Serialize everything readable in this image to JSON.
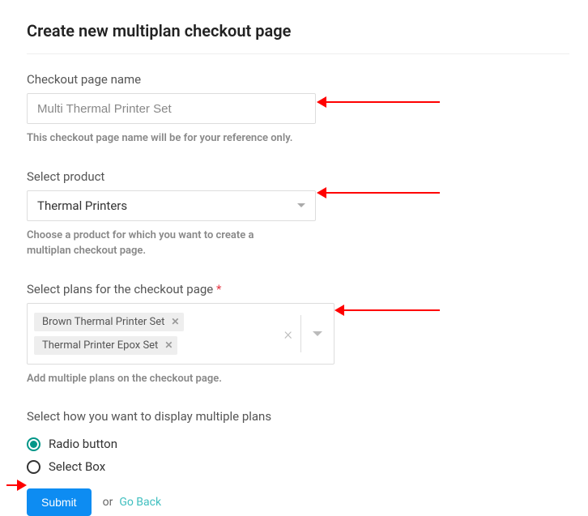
{
  "title": "Create new multiplan checkout page",
  "fields": {
    "name": {
      "label": "Checkout page name",
      "value": "Multi Thermal Printer Set",
      "help": "This checkout page name will be for your reference only."
    },
    "product": {
      "label": "Select product",
      "value": "Thermal Printers",
      "help": "Choose a product for which you want to create a multiplan checkout page."
    },
    "plans": {
      "label": "Select plans for the checkout page",
      "required": "*",
      "chips": [
        "Brown Thermal Printer Set",
        "Thermal Printer Epox Set"
      ],
      "help": "Add multiple plans on the checkout page."
    },
    "display": {
      "label": "Select how you want to display multiple plans",
      "options": {
        "radio": "Radio button",
        "select": "Select Box"
      }
    }
  },
  "actions": {
    "submit": "Submit",
    "or": "or",
    "goback": "Go Back"
  }
}
